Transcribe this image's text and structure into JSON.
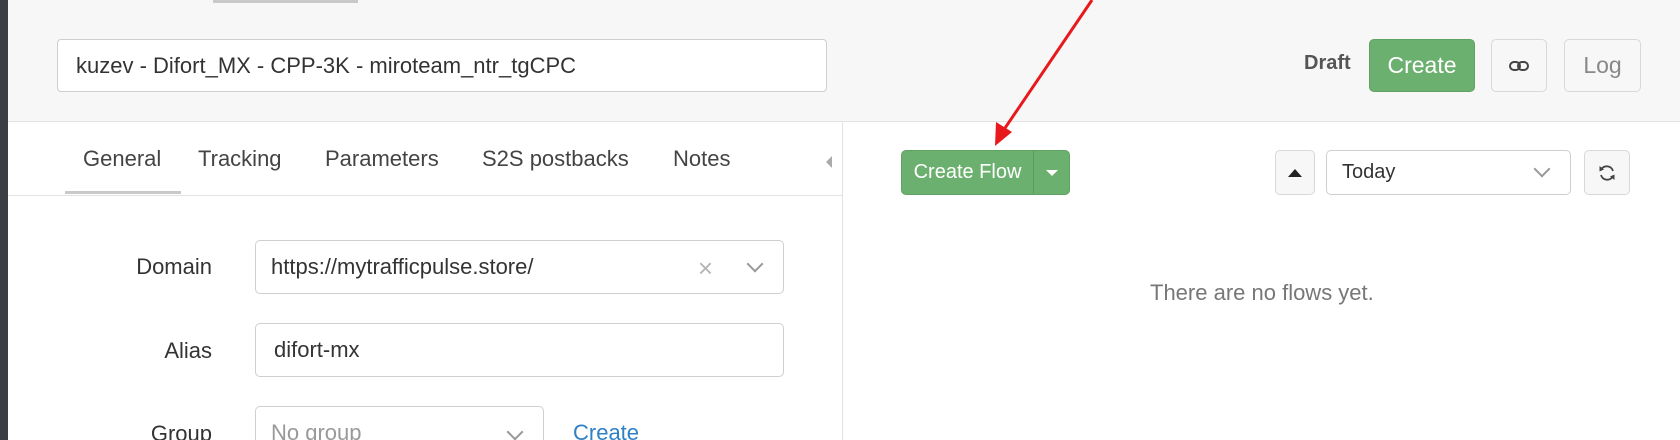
{
  "header": {
    "campaign_name": "kuzev - Difort_MX - CPP-3K - miroteam_ntr_tgCPC",
    "status": "Draft",
    "create_label": "Create",
    "log_label": "Log"
  },
  "tabs": [
    {
      "label": "General"
    },
    {
      "label": "Tracking"
    },
    {
      "label": "Parameters"
    },
    {
      "label": "S2S postbacks"
    },
    {
      "label": "Notes"
    }
  ],
  "form": {
    "domain_label": "Domain",
    "domain_value": "https://mytrafficpulse.store/",
    "alias_label": "Alias",
    "alias_value": "difort-mx",
    "group_label": "Group",
    "group_placeholder": "No group",
    "group_create_link": "Create"
  },
  "flows": {
    "create_flow_label": "Create Flow",
    "date_range": "Today",
    "empty_message": "There are no flows yet."
  },
  "colors": {
    "primary_green": "#6bb06f",
    "link_blue": "#2f80c5",
    "annotation_red": "#e8191c"
  }
}
